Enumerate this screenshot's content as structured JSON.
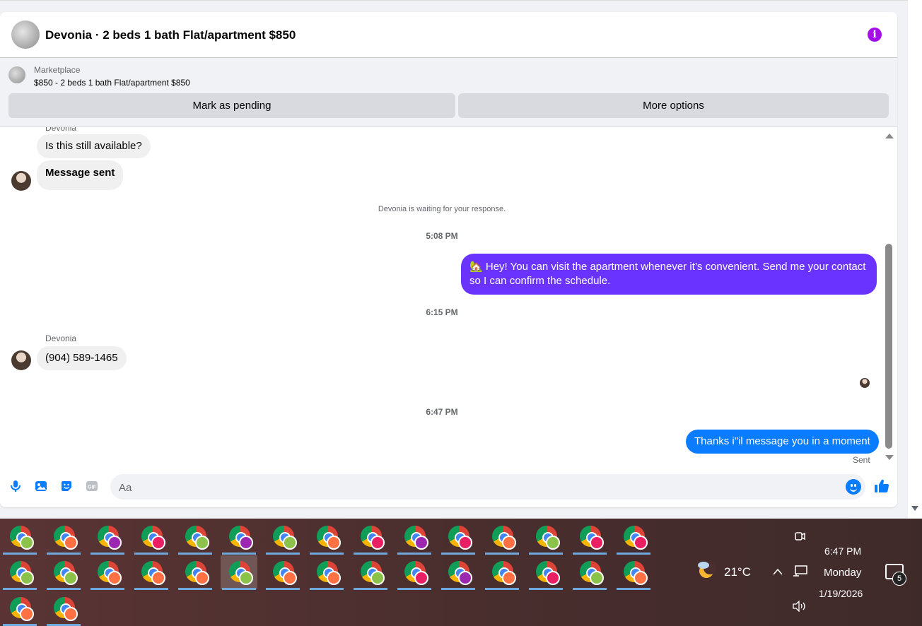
{
  "header": {
    "title": "Devonia · 2 beds 1 bath Flat/apartment $850"
  },
  "marketplace": {
    "label": "Marketplace",
    "listing": "$850 - 2 beds 1 bath Flat/apartment $850",
    "pending_button": "Mark as pending",
    "more_button": "More options"
  },
  "messages": {
    "sender_top": "Devonia",
    "msg1": "Is this still available?",
    "msg2": "Message sent",
    "waiting": "Devonia is waiting for your response.",
    "time1": "5:08 PM",
    "out1": "Hey! You can visit the apartment whenever it’s convenient. Send me your contact so I can confirm the schedule.",
    "time2": "6:15 PM",
    "sender2": "Devonia",
    "msg3": "(904) 589-1465",
    "time3": "6:47 PM",
    "out2": "Thanks i\"il message you in a moment",
    "sent_status": "Sent"
  },
  "composer": {
    "placeholder": "Aa"
  },
  "taskbar": {
    "temperature": "21°C",
    "time": "6:47 PM",
    "day": "Monday",
    "date": "1/19/2026",
    "notifications": "5",
    "app_badges": [
      "#8bc34a",
      "#ff7043",
      "#9c27b0",
      "#e91e63",
      "#8bc34a",
      "#9c27b0",
      "#8bc34a",
      "#ff7043",
      "#e91e63",
      "#9c27b0",
      "#e91e63",
      "#ff7043",
      "#8bc34a",
      "#e91e63",
      "#e91e63",
      "#8bc34a",
      "#8bc34a",
      "#ff7043",
      "#ff7043",
      "#ff7043",
      "#8bc34a",
      "#ff7043",
      "#ff7043",
      "#8bc34a",
      "#e91e63",
      "#9c27b0",
      "#ff7043",
      "#e91e63",
      "#8bc34a",
      "#ff7043",
      "#ff7043",
      "#ff7043"
    ]
  },
  "colors": {
    "accent_blue": "#0a7cff",
    "accent_purple": "#6a33ff",
    "info_purple": "#a30fe6"
  }
}
